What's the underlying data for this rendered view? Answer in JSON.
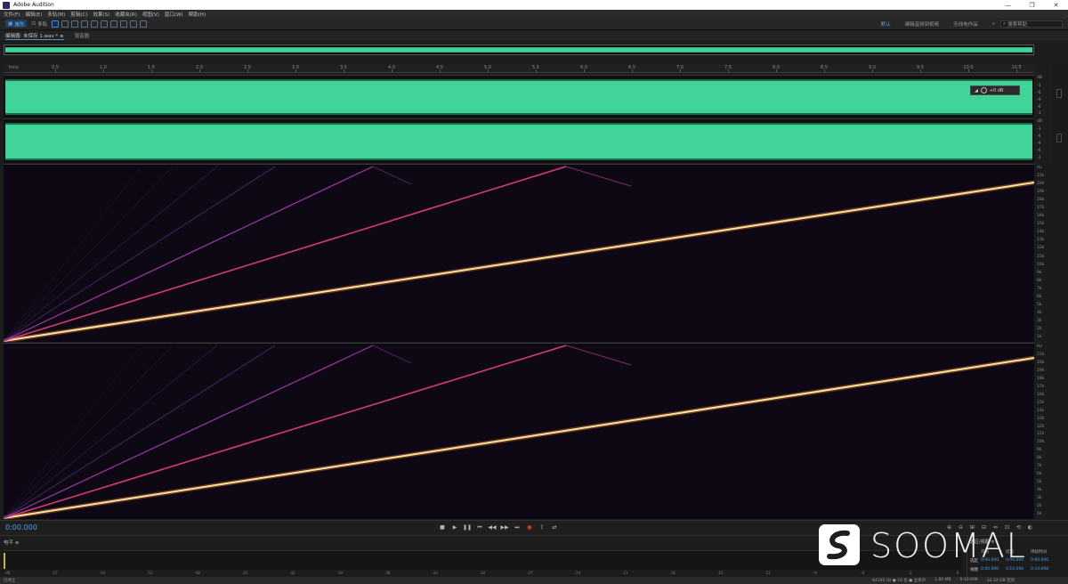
{
  "window": {
    "title": "Adobe Audition",
    "controls": [
      "—",
      "❐",
      "✕"
    ]
  },
  "menu": [
    "文件(F)",
    "编辑(E)",
    "多轨(M)",
    "剪辑(C)",
    "效果(S)",
    "收藏夹(R)",
    "视图(V)",
    "窗口(W)",
    "帮助(H)"
  ],
  "toolbar": {
    "waveform_label": "波形",
    "multitrack_label": "多轨",
    "workspace_default": "默认",
    "workspace_edit": "编辑音频到视频",
    "workspace_radio": "无线电作品",
    "more": "»",
    "search_placeholder": "搜索帮助"
  },
  "editor": {
    "tab_editor": "编辑器: 未保存 1.wav * ≡",
    "tab_mixer": "混音器"
  },
  "ruler": {
    "unit": "hms",
    "ticks": [
      "0.5",
      "1.0",
      "1.5",
      "2.0",
      "2.5",
      "3.0",
      "3.5",
      "4.0",
      "4.5",
      "5.0",
      "5.5",
      "6.0",
      "6.5",
      "7.0",
      "7.5",
      "8.0",
      "8.5",
      "9.0",
      "9.5",
      "10.0",
      "10.5"
    ]
  },
  "db_scale": {
    "left": [
      "dB",
      "-3",
      "-6",
      "-9",
      "-6",
      "-3"
    ],
    "right": [
      "dB",
      "-3",
      "-6",
      "-9",
      "-6",
      "-3"
    ]
  },
  "volume_hud": {
    "value": "+0 dB"
  },
  "hz_scale": [
    "Hz",
    "21k",
    "20k",
    "19k",
    "18k",
    "17k",
    "16k",
    "15k",
    "14k",
    "13k",
    "12k",
    "11k",
    "10k",
    "9k",
    "8k",
    "7k",
    "6k",
    "5k",
    "4k",
    "3k",
    "2k",
    "1k"
  ],
  "transport": {
    "timecode": "0:00.000",
    "buttons": [
      "■",
      "▶",
      "❚❚",
      "⏮",
      "◀◀",
      "▶▶",
      "⏭",
      "●",
      "⇪",
      "⇄"
    ],
    "zoom_buttons": [
      "⊕",
      "⊖",
      "⊞",
      "⊟",
      "⇔",
      "⊡",
      "⟲",
      "◐"
    ]
  },
  "levels": {
    "title": "电平 ≡",
    "scale": [
      "-dB",
      "-57",
      "-54",
      "-51",
      "-48",
      "-45",
      "-42",
      "-39",
      "-36",
      "-33",
      "-30",
      "-27",
      "-24",
      "-21",
      "-18",
      "-15",
      "-12",
      "-9",
      "-6",
      "-3",
      "0"
    ]
  },
  "selection": {
    "title": "选区/视图 ≡",
    "columns": [
      "开始",
      "结束",
      "持续时间"
    ],
    "rows": [
      {
        "label": "选区",
        "start": "0:00.000",
        "end": "0:00.000",
        "duration": "0:00.000"
      },
      {
        "label": "视图",
        "start": "0:00.000",
        "end": "0:10.698",
        "duration": "0:10.698"
      }
    ]
  },
  "status": {
    "left": "已停止",
    "right": [
      "44100 Hz ● 16 位 ● 立体声",
      "1.80 MB",
      "0:10.698",
      "33.32 GB 空闲"
    ]
  },
  "watermark": {
    "text": "SOOMAL"
  }
}
